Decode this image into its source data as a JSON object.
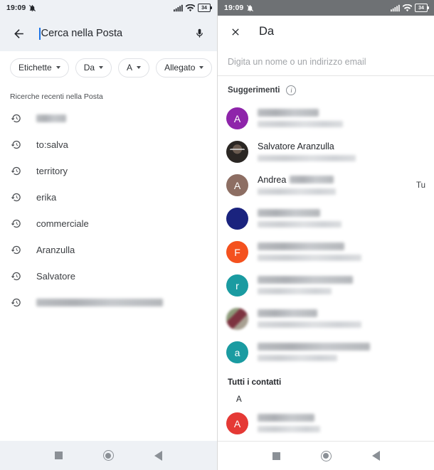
{
  "status_bar": {
    "time": "19:09",
    "mute_icon": "bell-muted-icon",
    "signal_icon": "signal-bars-icon",
    "wifi_icon": "wifi-icon",
    "battery_level": "34"
  },
  "left_panel": {
    "search": {
      "back_icon": "back-arrow-icon",
      "value": "Cerca nella Posta",
      "placeholder": "Cerca nella Posta",
      "mic_icon": "microphone-icon",
      "caret_color": "#1a73e8"
    },
    "chips": [
      {
        "label": "Etichette",
        "icon": "chevron-down-icon"
      },
      {
        "label": "Da",
        "icon": "chevron-down-icon"
      },
      {
        "label": "A",
        "icon": "chevron-down-icon"
      },
      {
        "label": "Allegato",
        "icon": "chevron-down-icon"
      },
      {
        "label": "",
        "icon": "chevron-down-icon"
      }
    ],
    "recents_label": "Ricerche recenti nella Posta",
    "recents": [
      {
        "text": "",
        "redacted": true,
        "width": 42,
        "icon": "history-clock-icon"
      },
      {
        "text": "to:salva",
        "redacted": false,
        "width": 0,
        "icon": "history-clock-icon"
      },
      {
        "text": "territory",
        "redacted": false,
        "width": 0,
        "icon": "history-clock-icon"
      },
      {
        "text": "erika",
        "redacted": false,
        "width": 0,
        "icon": "history-clock-icon"
      },
      {
        "text": "commerciale",
        "redacted": false,
        "width": 0,
        "icon": "history-clock-icon"
      },
      {
        "text": "Aranzulla",
        "redacted": false,
        "width": 0,
        "icon": "history-clock-icon"
      },
      {
        "text": "Salvatore",
        "redacted": false,
        "width": 0,
        "icon": "history-clock-icon"
      },
      {
        "text": "",
        "redacted": true,
        "width": 178,
        "icon": "history-clock-icon"
      }
    ]
  },
  "right_panel": {
    "header": {
      "close_icon": "close-x-icon",
      "title": "Da"
    },
    "email_input": {
      "placeholder": "Digita un nome o un indirizzo email",
      "value": ""
    },
    "suggestions_label": "Suggerimenti",
    "info_icon": "info-circle-icon",
    "info_icon_glyph": "i",
    "suggestions": [
      {
        "name": "",
        "name_redacted": true,
        "name_w": 86,
        "sub": "",
        "sub_redacted": true,
        "sub_w": 120,
        "avatar_type": "letter",
        "avatar_letter": "A",
        "avatar_color": "#8e24aa",
        "trailing": ""
      },
      {
        "name": "Salvatore Aranzulla",
        "name_redacted": false,
        "name_w": 0,
        "sub": "",
        "sub_redacted": true,
        "sub_w": 138,
        "avatar_type": "photo-face",
        "avatar_letter": "",
        "avatar_color": "#2b2724",
        "trailing": ""
      },
      {
        "name": "Andrea",
        "name_redacted": false,
        "name_w": 62,
        "name_partial_redacted": true,
        "sub": "",
        "sub_redacted": true,
        "sub_w": 110,
        "avatar_type": "letter",
        "avatar_letter": "A",
        "avatar_color": "#8d6e63",
        "trailing": "Tu"
      },
      {
        "name": "",
        "name_redacted": true,
        "name_w": 88,
        "sub": "",
        "sub_redacted": true,
        "sub_w": 118,
        "avatar_type": "letter",
        "avatar_letter": "",
        "avatar_color": "#1a237e",
        "trailing": ""
      },
      {
        "name": "",
        "name_redacted": true,
        "name_w": 122,
        "sub": "",
        "sub_redacted": true,
        "sub_w": 146,
        "avatar_type": "letter",
        "avatar_letter": "F",
        "avatar_color": "#f4511e",
        "trailing": ""
      },
      {
        "name": "",
        "name_redacted": true,
        "name_w": 134,
        "sub": "",
        "sub_redacted": true,
        "sub_w": 104,
        "avatar_type": "letter",
        "avatar_letter": "r",
        "avatar_color": "#1a9ba1",
        "trailing": ""
      },
      {
        "name": "",
        "name_redacted": true,
        "name_w": 84,
        "sub": "",
        "sub_redacted": true,
        "sub_w": 146,
        "avatar_type": "photo-blur",
        "avatar_letter": "",
        "avatar_color": "#8d9b7a",
        "trailing": ""
      },
      {
        "name": "",
        "name_redacted": true,
        "name_w": 158,
        "sub": "",
        "sub_redacted": true,
        "sub_w": 112,
        "avatar_type": "letter",
        "avatar_letter": "a",
        "avatar_color": "#1a9ba1",
        "trailing": ""
      }
    ],
    "all_contacts_label": "Tutti i contatti",
    "alpha_sections": [
      {
        "letter": "A",
        "contacts": [
          {
            "name": "",
            "name_redacted": true,
            "name_w": 80,
            "sub": "",
            "sub_redacted": true,
            "sub_w": 88,
            "avatar_type": "letter",
            "avatar_letter": "A",
            "avatar_color": "#e53935",
            "trailing": ""
          }
        ]
      }
    ]
  },
  "nav_bar": {
    "recents_icon": "square-recents-icon",
    "home_icon": "circle-home-icon",
    "back_icon": "triangle-back-icon"
  }
}
